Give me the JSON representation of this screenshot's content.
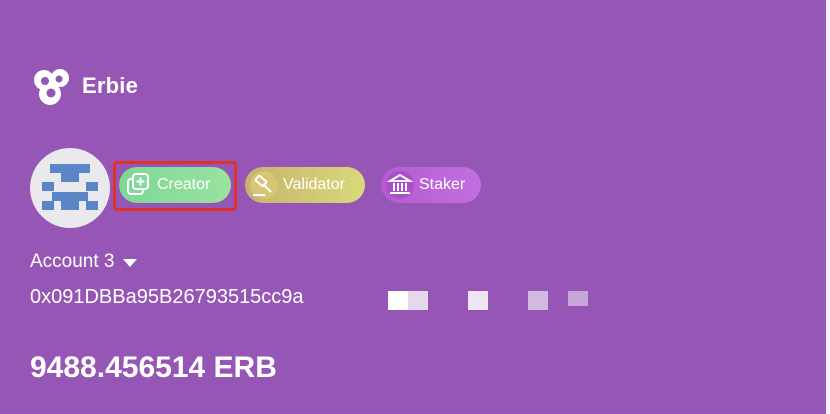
{
  "brand": {
    "name": "Erbie",
    "logo_icon": "erbie-logo-icon"
  },
  "profile": {
    "avatar_icon": "identicon-avatar"
  },
  "roles": [
    {
      "label": "Creator",
      "icon": "creator-plus-icon",
      "color": "#8ddc9b"
    },
    {
      "label": "Validator",
      "icon": "gavel-icon",
      "color": "#d2c873"
    },
    {
      "label": "Staker",
      "icon": "bank-icon",
      "color": "#bd66db"
    }
  ],
  "account": {
    "name": "Account 3",
    "address": "0x091DBBa95B26793515cc9a"
  },
  "balance": {
    "text": "9488.456514 ERB"
  },
  "colors": {
    "background": "#9556b5",
    "highlight": "#e0312b"
  }
}
